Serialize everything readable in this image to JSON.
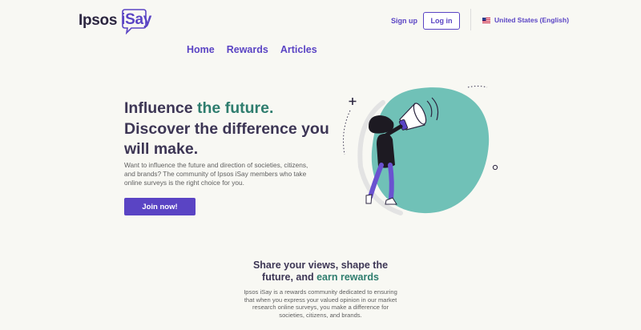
{
  "brand": {
    "ipsos": "Ipsos",
    "isay": "iSay",
    "purple": "#5a44c4",
    "teal": "#2e7d6e",
    "blob": "#70c1b7"
  },
  "header": {
    "signup_label": "Sign up",
    "login_label": "Log in",
    "locale_label": "United States (English)",
    "locale_icon": "us-flag-icon"
  },
  "nav": {
    "items": [
      "Home",
      "Rewards",
      "Articles"
    ]
  },
  "hero": {
    "title_part1": "Influence ",
    "title_accent": "the future.",
    "title_part2": "Discover the difference you will make.",
    "description": "Want to influence the future and direction of societies, citizens, and brands? The community of Ipsos iSay members who take online surveys is the right choice for you.",
    "cta_label": "Join now!"
  },
  "section": {
    "title_part1": "Share your views, shape the future, and ",
    "title_accent": "earn rewards",
    "description": "Ipsos iSay is a rewards community dedicated to ensuring that when you express your valued opinion in our market research online surveys, you make a difference for societies, citizens, and brands."
  }
}
